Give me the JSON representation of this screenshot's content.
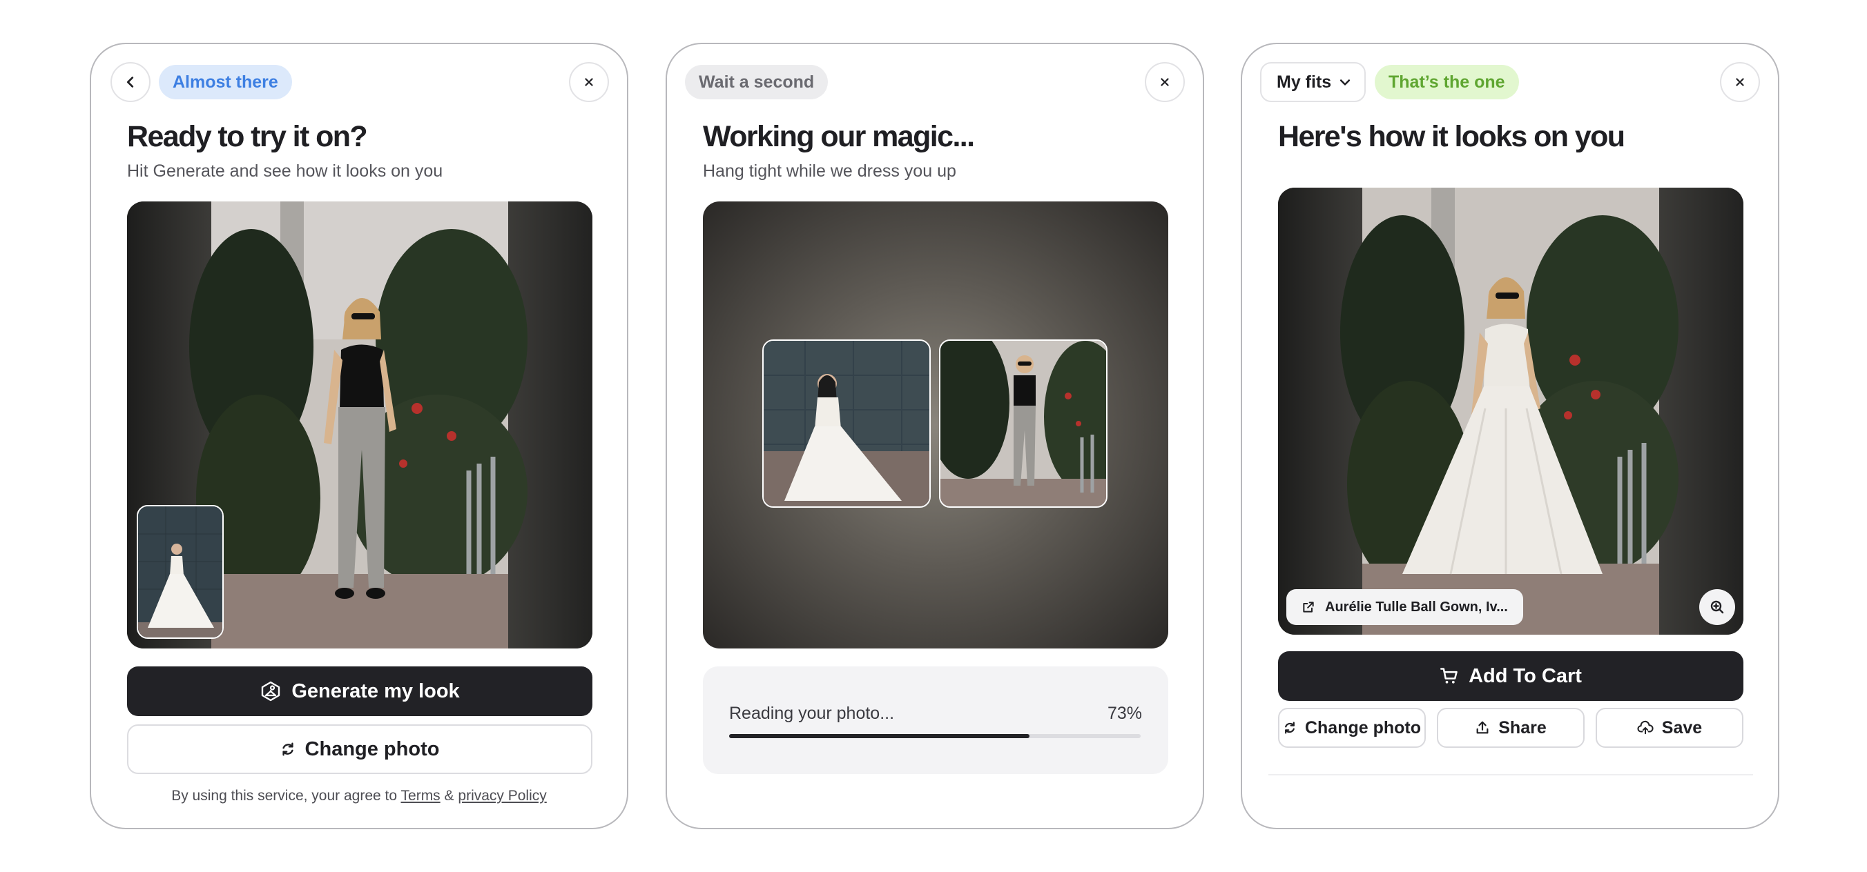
{
  "panel1": {
    "pill": "Almost there",
    "title": "Ready to try it on?",
    "subtitle": "Hit Generate and see how it looks on you",
    "generate_label": "Generate my look",
    "change_photo_label": "Change photo",
    "legal_prefix": "By using this service, your agree to",
    "terms_label": "Terms",
    "amp": "&",
    "privacy_label": "privacy Policy"
  },
  "panel2": {
    "pill": "Wait a second",
    "title": "Working our magic...",
    "subtitle": "Hang tight while we dress you up",
    "progress_label": "Reading your photo...",
    "progress_value": 73,
    "progress_text": "73%"
  },
  "panel3": {
    "dropdown_label": "My fits",
    "pill": "That’s the one",
    "title": "Here's how it looks on you",
    "product_label": "Aurélie Tulle Ball Gown, Iv...",
    "add_to_cart_label": "Add To Cart",
    "change_photo_label": "Change photo",
    "share_label": "Share",
    "save_label": "Save"
  },
  "icons": {
    "back": "chevron-left-icon",
    "close": "close-icon",
    "generate": "hanger-icon",
    "refresh": "refresh-icon",
    "chevron": "chevron-down-icon",
    "external": "external-link-icon",
    "zoom": "zoom-in-icon",
    "cart": "cart-icon",
    "share": "share-icon",
    "save": "cloud-upload-icon"
  },
  "colors": {
    "dark_button": "#222226",
    "pill_blue_bg": "#dce9fb",
    "pill_blue_text": "#3d7fe2",
    "pill_green_bg": "#e2f7cf",
    "pill_green_text": "#5fa631",
    "progress_fill": "#222226"
  }
}
